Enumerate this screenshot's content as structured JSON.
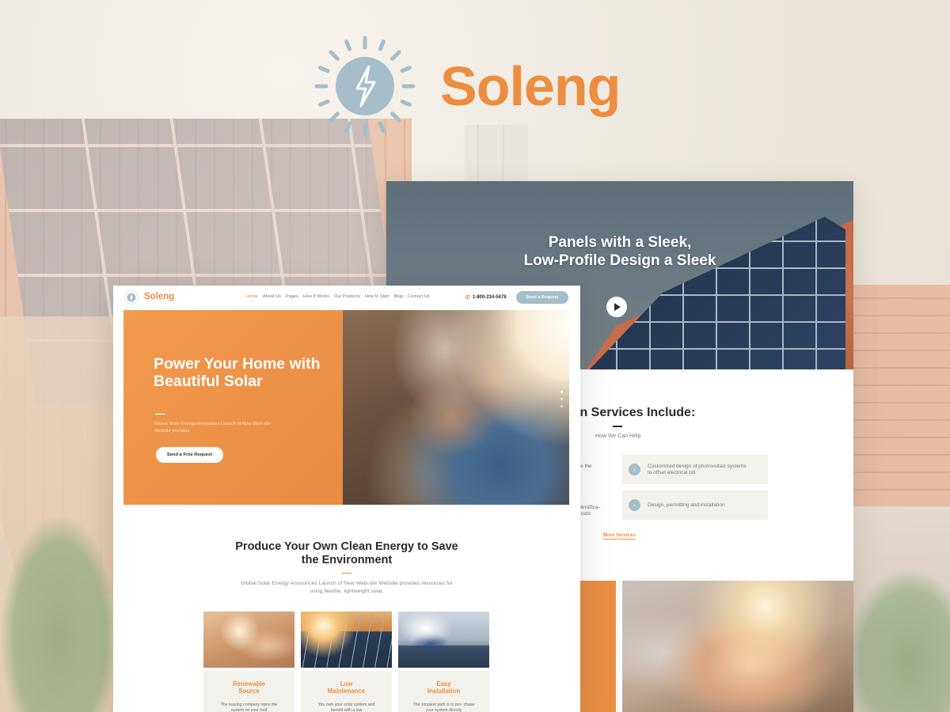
{
  "brand": {
    "name": "Soleng"
  },
  "back_window": {
    "hero_title_line1": "Panels with a Sleek,",
    "hero_title_line2": "Low-Profile Design a Sleek",
    "services_title": "in Services Include:",
    "services_subtitle": "How We Can Help",
    "service_cards": [
      {
        "label": "Customized design of photovoltaic systems to offset electrical bill"
      },
      {
        "label": "Design, permitting and installation"
      }
    ],
    "partial_cards": [
      {
        "label": "define the"
      },
      {
        "label": "identifica-\nthods"
      }
    ],
    "more_link": "More Services"
  },
  "front_window": {
    "nav": {
      "brand": "Soleng",
      "links": [
        "Home",
        "About Us",
        "Pages",
        "How It Works",
        "Our Products",
        "How to Start",
        "Blog",
        "Contact Us"
      ],
      "active_link": "Home",
      "phone": "1-800-234-5678",
      "cta": "Send a Request"
    },
    "hero": {
      "title": "Power Your Home with Beautiful Solar",
      "text": "Global Solar Energy Announces Launch of New Web-site Website provides",
      "button": "Send a Free Request"
    },
    "section": {
      "title_line1": "Produce Your Own Clean Energy to Save",
      "title_line2": "the Environment",
      "text": "Global Solar Energy Announces Launch of New Web-site Website provides resources for using flexible, lightweight solar."
    },
    "features": [
      {
        "title_line1": "Renewable",
        "title_line2": "Source",
        "text": "The leasing company owns the system on your roof"
      },
      {
        "title_line1": "Low",
        "title_line2": "Maintenance",
        "text": "You own your solar system and benefit with a low"
      },
      {
        "title_line1": "Easy",
        "title_line2": "Installation",
        "text": "The simplest path is to pur- chase your system directly"
      }
    ]
  },
  "colors": {
    "accent": "#ec8d3f",
    "secondary": "#a6bdca",
    "dark": "#2b2b2b"
  },
  "icons": [
    "sun-bolt-logo-icon",
    "play-icon",
    "chevron-right-icon",
    "phone-icon"
  ]
}
